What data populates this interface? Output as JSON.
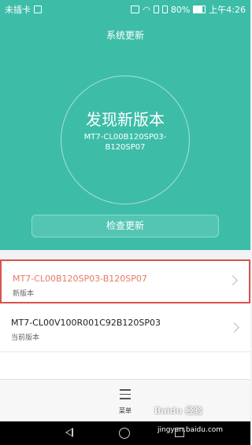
{
  "status_bar": {
    "carrier": "未插卡",
    "battery": "80%",
    "time": "上午4:26",
    "icons": [
      "sim-missing-icon",
      "nfc-icon",
      "wifi-icon",
      "signal-icon",
      "battery-icon"
    ]
  },
  "header": {
    "title": "系统更新"
  },
  "hero": {
    "headline": "发现新版本",
    "version_line1": "MT7-CL00B120SP03-",
    "version_line2": "B120SP07",
    "accent_color": "#3dbda8"
  },
  "actions": {
    "check_label": "检查更新"
  },
  "versions": [
    {
      "name": "MT7-CL00B120SP03-B120SP07",
      "subtitle": "新版本",
      "highlight_color": "#d9534f"
    },
    {
      "name": "MT7-CL00V100R001C92B120SP03",
      "subtitle": "当前版本"
    }
  ],
  "bottom_menu": {
    "label": "菜单"
  },
  "watermark": {
    "brand": "Baidu 经验",
    "url": "jingyan.baidu.com"
  }
}
